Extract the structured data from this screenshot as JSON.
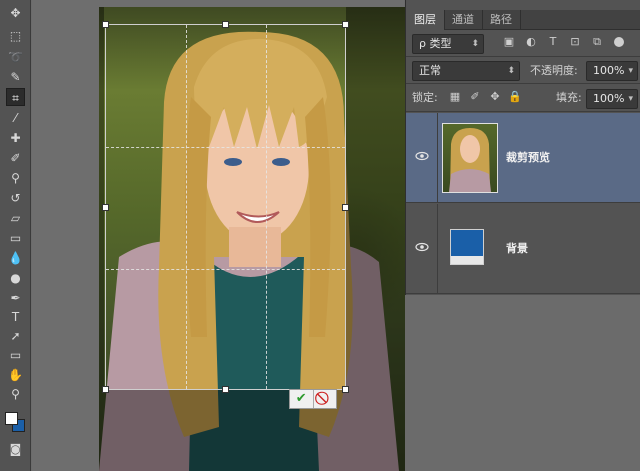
{
  "layers_panel": {
    "tabs": [
      "图层",
      "通道",
      "路径"
    ],
    "filter": {
      "label": "ρ 类型"
    },
    "blend_mode": "正常",
    "opacity_label": "不透明度:",
    "opacity_value": "100%",
    "lock_label": "锁定:",
    "fill_label": "填充:",
    "fill_value": "100%",
    "layers": [
      {
        "name": "裁剪预览",
        "selected": true,
        "thumb": "portrait"
      },
      {
        "name": "背景",
        "selected": false,
        "thumb": "solid-blue"
      }
    ]
  },
  "crop_commit": {
    "commit_icon": "✔",
    "cancel_icon": "⃠"
  },
  "toolbar": {
    "tools": [
      "move-tool",
      "marquee-tool",
      "lasso-tool",
      "quick-select-tool",
      "crop-tool",
      "eyedropper-tool",
      "healing-brush-tool",
      "brush-tool",
      "clone-stamp-tool",
      "history-brush-tool",
      "eraser-tool",
      "gradient-tool",
      "blur-tool",
      "dodge-tool",
      "pen-tool",
      "type-tool",
      "path-select-tool",
      "shape-tool",
      "hand-tool",
      "zoom-tool"
    ],
    "active_tool": "crop-tool"
  },
  "colors": {
    "foreground": "#ffffff",
    "background": "#1a5fa8",
    "selected_layer": "#5a6a86"
  }
}
